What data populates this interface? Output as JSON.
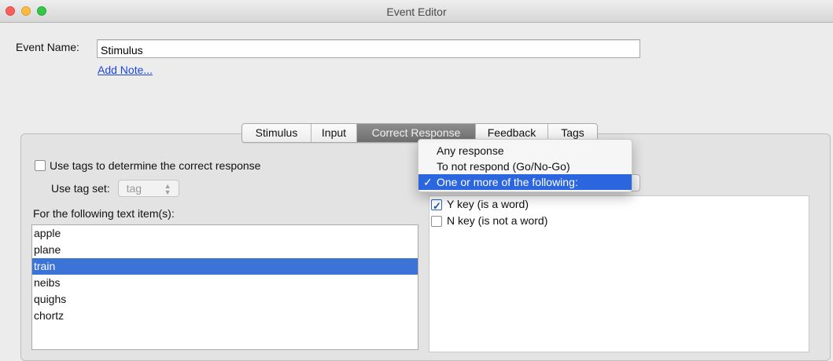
{
  "window": {
    "title": "Event Editor"
  },
  "event": {
    "name_label": "Event Name:",
    "name_value": "Stimulus",
    "add_note": "Add Note..."
  },
  "tabs": [
    {
      "label": "Stimulus"
    },
    {
      "label": "Input"
    },
    {
      "label": "Correct Response",
      "selected": true
    },
    {
      "label": "Feedback"
    },
    {
      "label": "Tags"
    }
  ],
  "left_panel": {
    "use_tags_label": "Use tags to determine the correct response",
    "use_tags_checked": false,
    "tag_set_label": "Use tag set:",
    "tag_set_value": "tag",
    "items_label": "For the following text item(s):",
    "items": [
      "apple",
      "plane",
      "train",
      "neibs",
      "quighs",
      "chortz"
    ],
    "selected_item": "train"
  },
  "response_dropdown": {
    "options": [
      {
        "label": "Any response",
        "checked": false
      },
      {
        "label": "To not respond (Go/No-Go)",
        "checked": false
      },
      {
        "label": "One or more of the following:",
        "checked": true
      }
    ],
    "check_glyph": "✓"
  },
  "responses": [
    {
      "label": "Y key (is a word)",
      "checked": true
    },
    {
      "label": "N key (is not a word)",
      "checked": false
    }
  ],
  "colors": {
    "selection": "#3b73d6",
    "link": "#1f47d6",
    "menu_highlight": "#2b66de"
  }
}
